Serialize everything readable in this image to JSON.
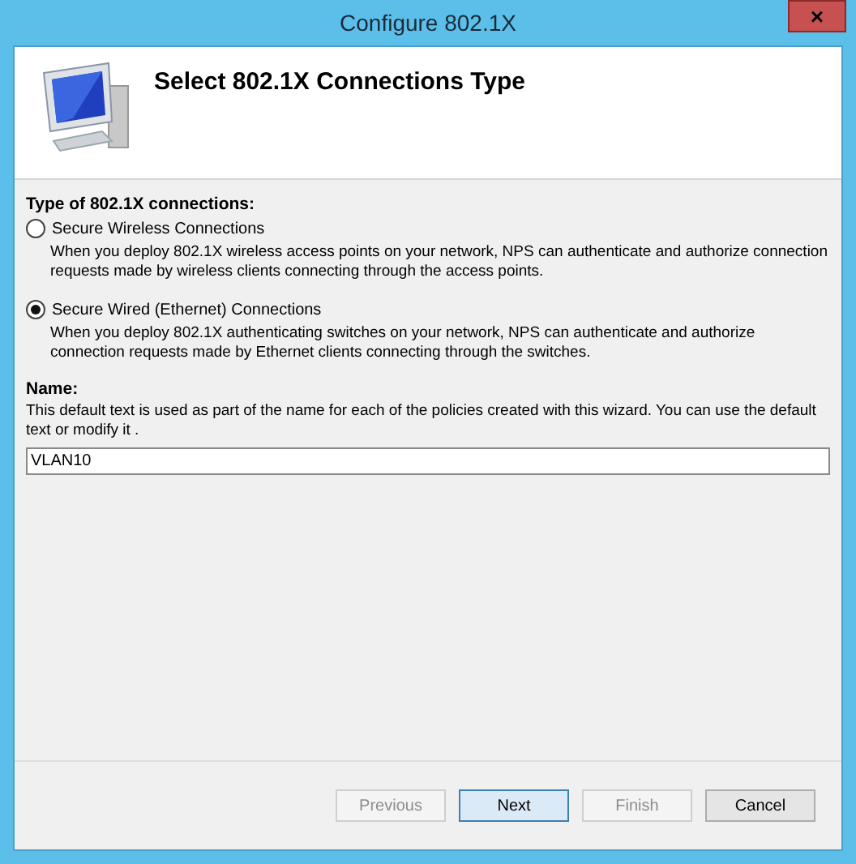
{
  "window": {
    "title": "Configure 802.1X",
    "close": "×"
  },
  "header": {
    "title": "Select 802.1X Connections Type"
  },
  "connection_type": {
    "label": "Type of  802.1X connections:",
    "options": [
      {
        "label": "Secure Wireless Connections",
        "selected": false,
        "description": "When you deploy 802.1X wireless access points on your network, NPS can authenticate and authorize connection requests made by wireless clients connecting through the access points."
      },
      {
        "label": "Secure Wired (Ethernet) Connections",
        "selected": true,
        "description": "When you deploy 802.1X authenticating switches on your network, NPS can authenticate and authorize connection requests made by Ethernet clients connecting through the switches."
      }
    ]
  },
  "name": {
    "label": "Name:",
    "description": "This default text is used as part of the name for each of the policies created with this wizard. You can use the default text or modify it .",
    "value": "VLAN10"
  },
  "buttons": [
    {
      "label": "Previous",
      "disabled": true,
      "focused": false
    },
    {
      "label": "Next",
      "disabled": false,
      "focused": true
    },
    {
      "label": "Finish",
      "disabled": true,
      "focused": false
    },
    {
      "label": "Cancel",
      "disabled": false,
      "focused": false
    }
  ]
}
